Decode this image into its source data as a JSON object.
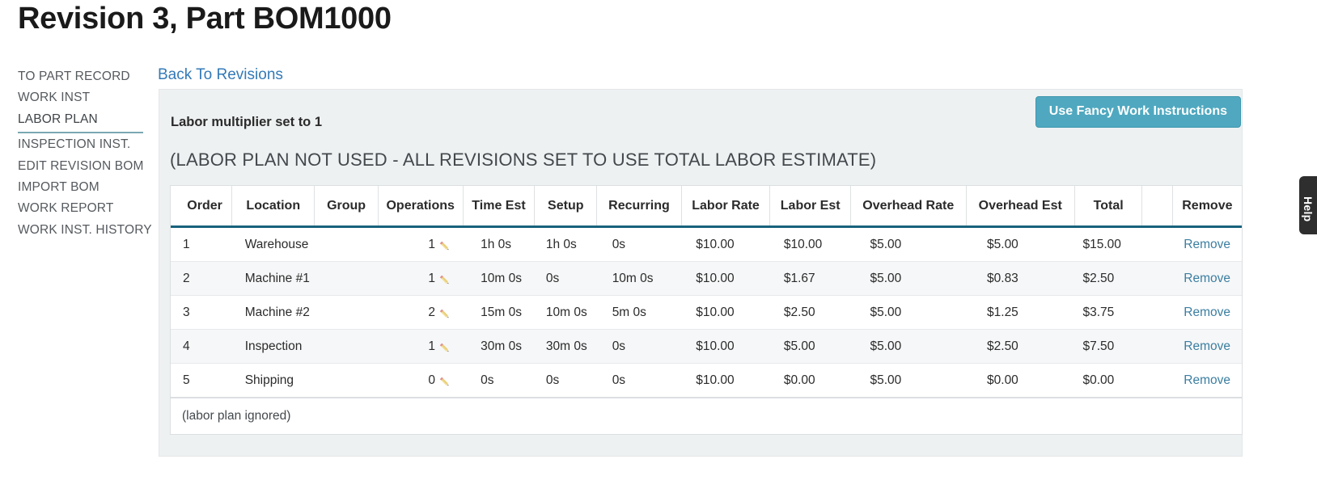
{
  "page_title": "Revision 3, Part BOM1000",
  "sidebar": {
    "items": [
      {
        "label": "TO PART RECORD",
        "active": false
      },
      {
        "label": "WORK INST",
        "active": false
      },
      {
        "label": "LABOR PLAN",
        "active": true
      },
      {
        "label": "INSPECTION INST.",
        "active": false
      },
      {
        "label": "EDIT REVISION BOM",
        "active": false
      },
      {
        "label": "IMPORT BOM",
        "active": false
      },
      {
        "label": "WORK REPORT",
        "active": false
      },
      {
        "label": "WORK INST. HISTORY",
        "active": false
      }
    ]
  },
  "back_link": "Back To Revisions",
  "panel": {
    "fancy_button": "Use Fancy Work Instructions",
    "multiplier_text": "Labor multiplier set to 1",
    "notice_text": "(LABOR PLAN NOT USED - ALL REVISIONS SET TO USE TOTAL LABOR ESTIMATE)",
    "footer_text": "(labor plan ignored)"
  },
  "table": {
    "headers": [
      "Order",
      "Location",
      "Group",
      "Operations",
      "Time Est",
      "Setup",
      "Recurring",
      "Labor Rate",
      "Labor Est",
      "Overhead Rate",
      "Overhead Est",
      "Total",
      "",
      "Remove"
    ],
    "remove_label": "Remove",
    "rows": [
      {
        "order": "1",
        "location": "Warehouse",
        "group": "",
        "operations": "1",
        "time_est": "1h 0s",
        "setup": "1h 0s",
        "recurring": "0s",
        "labor_rate": "$10.00",
        "labor_est": "$10.00",
        "overhead_rate": "$5.00",
        "overhead_est": "$5.00",
        "total": "$15.00"
      },
      {
        "order": "2",
        "location": "Machine #1",
        "group": "",
        "operations": "1",
        "time_est": "10m 0s",
        "setup": "0s",
        "recurring": "10m 0s",
        "labor_rate": "$10.00",
        "labor_est": "$1.67",
        "overhead_rate": "$5.00",
        "overhead_est": "$0.83",
        "total": "$2.50"
      },
      {
        "order": "3",
        "location": "Machine #2",
        "group": "",
        "operations": "2",
        "time_est": "15m 0s",
        "setup": "10m 0s",
        "recurring": "5m 0s",
        "labor_rate": "$10.00",
        "labor_est": "$2.50",
        "overhead_rate": "$5.00",
        "overhead_est": "$1.25",
        "total": "$3.75"
      },
      {
        "order": "4",
        "location": "Inspection",
        "group": "",
        "operations": "1",
        "time_est": "30m 0s",
        "setup": "30m 0s",
        "recurring": "0s",
        "labor_rate": "$10.00",
        "labor_est": "$5.00",
        "overhead_rate": "$5.00",
        "overhead_est": "$2.50",
        "total": "$7.50"
      },
      {
        "order": "5",
        "location": "Shipping",
        "group": "",
        "operations": "0",
        "time_est": "0s",
        "setup": "0s",
        "recurring": "0s",
        "labor_rate": "$10.00",
        "labor_est": "$0.00",
        "overhead_rate": "$5.00",
        "overhead_est": "$0.00",
        "total": "$0.00"
      }
    ]
  },
  "help_tab": {
    "label": "Help"
  },
  "colors": {
    "accent_teal": "#4fa8bf",
    "link_blue": "#337ab7",
    "header_border": "#18627c",
    "panel_bg": "#eef1f2",
    "help_tab_bg": "#2e2e2e",
    "pencil_body": "#e8d27a",
    "pencil_eraser": "#e49a9a"
  }
}
